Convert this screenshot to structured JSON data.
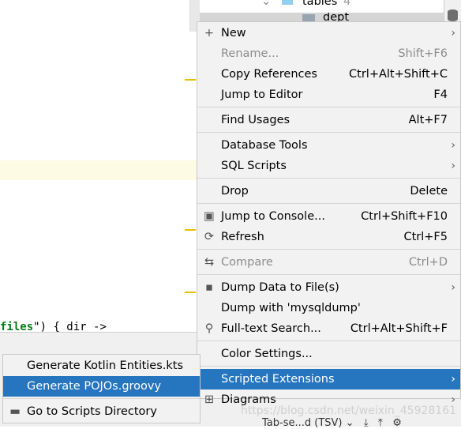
{
  "tree": {
    "folder_label": "tables",
    "folder_count": "4",
    "row_label": "dept"
  },
  "code_line": {
    "string": "files",
    "rest": "\") { dir ->",
    "quote": "\""
  },
  "menu": {
    "items": [
      {
        "label": "New",
        "icon": "plus-icon",
        "submenu": true
      },
      {
        "label": "Rename...",
        "shortcut": "Shift+F6",
        "disabled": true
      },
      {
        "label": "Copy References",
        "shortcut": "Ctrl+Alt+Shift+C"
      },
      {
        "label": "Jump to Editor",
        "shortcut": "F4"
      },
      {
        "label": "Find Usages",
        "shortcut": "Alt+F7"
      },
      {
        "label": "Database Tools",
        "submenu": true
      },
      {
        "label": "SQL Scripts",
        "submenu": true
      },
      {
        "label": "Drop",
        "shortcut": "Delete"
      },
      {
        "label": "Jump to Console...",
        "shortcut": "Ctrl+Shift+F10",
        "icon": "console-icon"
      },
      {
        "label": "Refresh",
        "shortcut": "Ctrl+F5",
        "icon": "refresh-icon"
      },
      {
        "label": "Compare",
        "shortcut": "Ctrl+D",
        "icon": "compare-icon",
        "disabled": true
      },
      {
        "label": "Dump Data to File(s)",
        "icon": "save-icon",
        "submenu": true
      },
      {
        "label": "Dump with 'mysqldump'"
      },
      {
        "label": "Full-text Search...",
        "shortcut": "Ctrl+Alt+Shift+F",
        "icon": "search-icon"
      },
      {
        "label": "Color Settings..."
      },
      {
        "label": "Scripted Extensions",
        "submenu": true,
        "selected": true
      },
      {
        "label": "Diagrams",
        "icon": "diagram-icon",
        "submenu": true
      }
    ]
  },
  "submenu": {
    "items": [
      {
        "label": "Generate Kotlin Entities.kts"
      },
      {
        "label": "Generate POJOs.groovy",
        "selected": true
      },
      {
        "label": "Go to Scripts Directory",
        "icon": "folder-icon"
      }
    ]
  },
  "status": {
    "separator_label": "Tab-se...d (TSV)"
  },
  "watermark": "https://blog.csdn.net/weixin_45928161",
  "colors": {
    "selection": "#2675bf",
    "menu_bg": "#f2f2f2"
  }
}
